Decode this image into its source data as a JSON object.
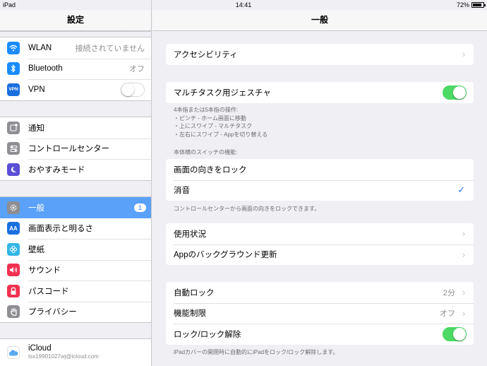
{
  "status_bar": {
    "device": "iPad",
    "time": "14:41",
    "battery": "72%",
    "battery_level": 0.72
  },
  "sidebar": {
    "title": "設定",
    "group1": [
      {
        "label": "WLAN",
        "value": "接続されていません",
        "icon": "wifi-icon",
        "color": "#1a8cff"
      },
      {
        "label": "Bluetooth",
        "value": "オフ",
        "icon": "bluetooth-icon",
        "color": "#1a8cff"
      },
      {
        "label": "VPN",
        "icon": "vpn-icon",
        "color": "#1a6fdf",
        "icon_text": "VPN",
        "switch": false
      }
    ],
    "group2": [
      {
        "label": "通知",
        "icon": "notifications-icon",
        "color": "#8e8e93"
      },
      {
        "label": "コントロールセンター",
        "icon": "control-center-icon",
        "color": "#8e8e93"
      },
      {
        "label": "おやすみモード",
        "icon": "moon-icon",
        "color": "#5b4fd6"
      }
    ],
    "group3": [
      {
        "label": "一般",
        "icon": "gear-icon",
        "color": "#8e8e93",
        "badge": "1",
        "selected": true
      },
      {
        "label": "画面表示と明るさ",
        "icon": "display-icon",
        "color": "#1a6fdf",
        "icon_text": "AA"
      },
      {
        "label": "壁紙",
        "icon": "wallpaper-icon",
        "color": "#33b5e5"
      },
      {
        "label": "サウンド",
        "icon": "sound-icon",
        "color": "#f0304f"
      },
      {
        "label": "パスコード",
        "icon": "lock-icon",
        "color": "#f0304f"
      },
      {
        "label": "プライバシー",
        "icon": "hand-icon",
        "color": "#8e8e93"
      }
    ],
    "group4": [
      {
        "label": "iCloud",
        "sublabel": "tsx19901027wj@icloud.com",
        "icon": "icloud-icon",
        "color": "#ffffff"
      }
    ]
  },
  "main": {
    "title": "一般",
    "accessibility": "アクセシビリティ",
    "multitask": {
      "label": "マルチタスク用ジェスチャ",
      "on": true
    },
    "multitask_note": [
      "4本指または5本指の操作:",
      "・ピンチ - ホーム画面に移動",
      "・上にスワイプ - マルチタスク",
      "・左右にスワイプ - Appを切り替える"
    ],
    "side_switch_header": "本体横のスイッチの機能:",
    "side_switch": [
      {
        "label": "画面の向きをロック",
        "checked": false
      },
      {
        "label": "消音",
        "checked": true
      }
    ],
    "side_switch_note": "コントロールセンターから画面の向きをロックできます。",
    "usage": [
      "使用状況",
      "Appのバックグラウンド更新"
    ],
    "lock": [
      {
        "label": "自動ロック",
        "value": "2分"
      },
      {
        "label": "機能制限",
        "value": "オフ"
      },
      {
        "label": "ロック/ロック解除",
        "switch": true
      }
    ],
    "lock_note": "iPadカバーの開閉時に自動的にiPadをロック/ロック解除します。",
    "checkmark": "✓",
    "chevron": "›"
  }
}
